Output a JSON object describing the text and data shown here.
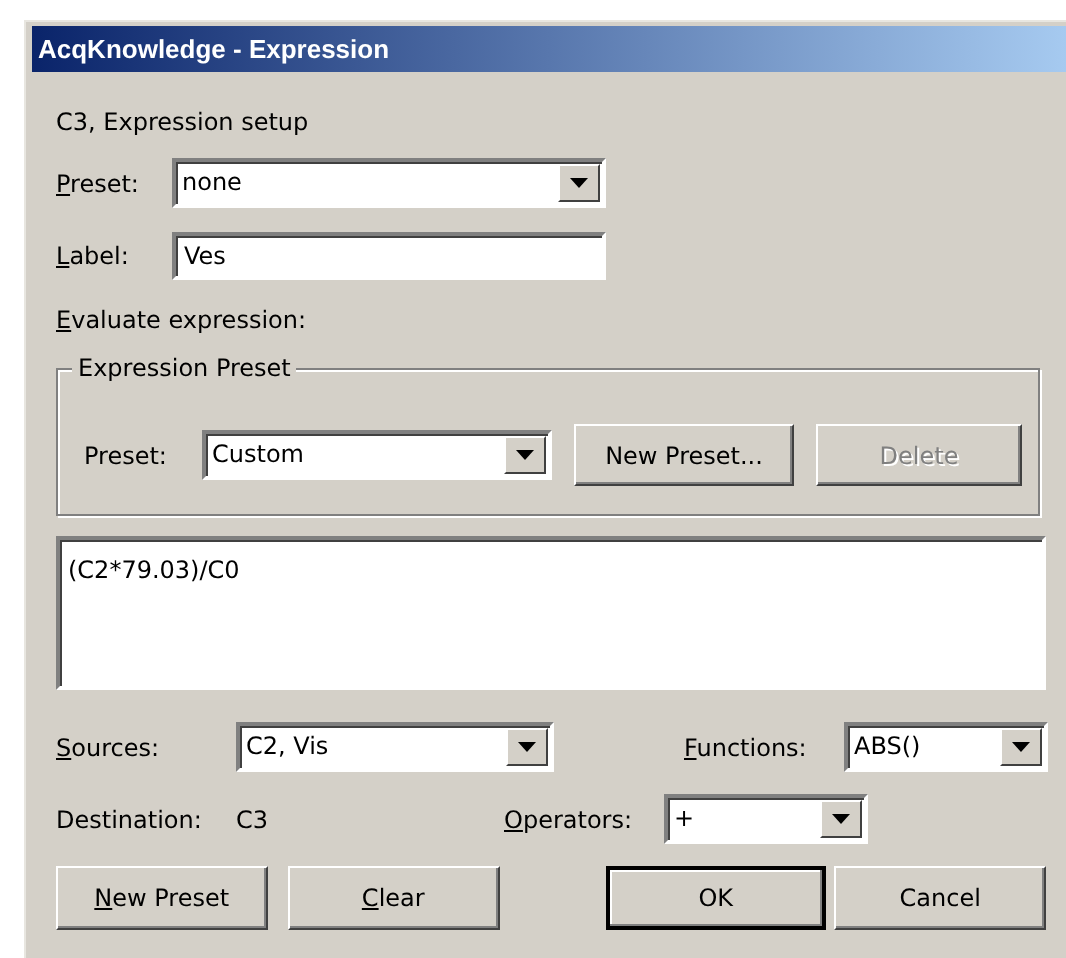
{
  "window": {
    "title": "AcqKnowledge - Expression"
  },
  "heading": "C3, Expression setup",
  "preset": {
    "label": {
      "key": "P",
      "post": "reset:"
    },
    "value": "none"
  },
  "label_field": {
    "label": {
      "key": "L",
      "post": "abel:"
    },
    "value": "Ves"
  },
  "evaluate_label": {
    "key": "E",
    "post": "valuate expression:"
  },
  "expression_preset": {
    "title": "Expression Preset",
    "label": "Preset:",
    "value": "Custom",
    "buttons": [
      {
        "label": "New Preset...",
        "disabled": false
      },
      {
        "label": "Delete",
        "disabled": true
      }
    ]
  },
  "expression": "(C2*79.03)/C0",
  "sources": {
    "label": {
      "key": "S",
      "post": "ources:"
    },
    "value": "C2, Vis"
  },
  "functions": {
    "label": {
      "key": "F",
      "post": "unctions:"
    },
    "value": "ABS()"
  },
  "destination": {
    "label": "Destination:",
    "value": "C3"
  },
  "operators": {
    "label": {
      "key": "O",
      "post": "perators:"
    },
    "value": "+"
  },
  "buttons": [
    {
      "label": {
        "key": "N",
        "post": "ew Preset"
      },
      "default": false
    },
    {
      "label": {
        "key": "C",
        "post": "lear"
      },
      "default": false
    },
    {
      "label": "OK",
      "default": true
    },
    {
      "label": "Cancel",
      "default": false
    }
  ]
}
